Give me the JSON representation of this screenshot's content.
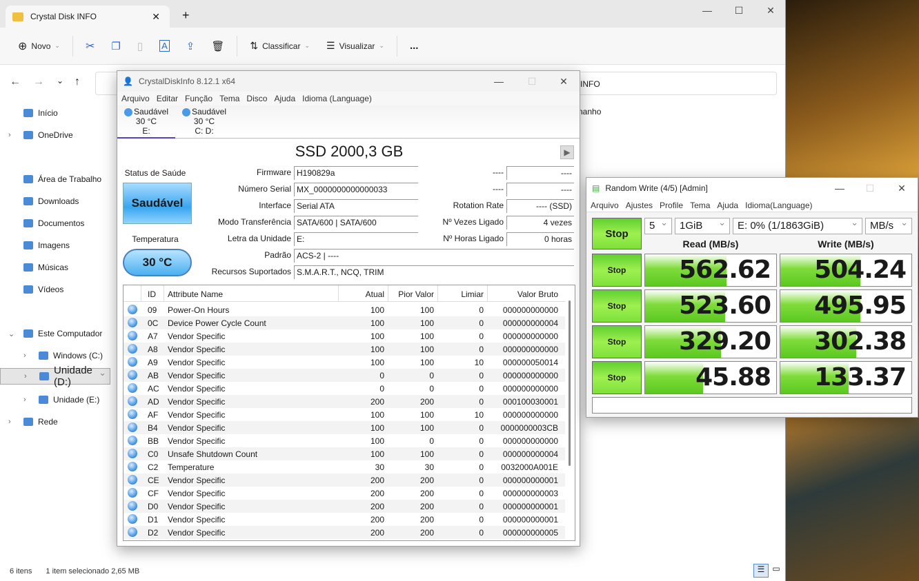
{
  "explorer": {
    "tab_title": "Crystal Disk INFO",
    "new_tab": "+",
    "toolbar": {
      "new": "Novo",
      "sort": "Classificar",
      "view": "Visualizar",
      "more": "..."
    },
    "address_tail": "INFO",
    "column_tail": "nanho",
    "sidebar": [
      {
        "label": "Início",
        "icon": "home-icon"
      },
      {
        "label": "OneDrive",
        "icon": "cloud-icon",
        "expand": true
      },
      {
        "label": "Área de Trabalho",
        "icon": "desktop-icon"
      },
      {
        "label": "Downloads",
        "icon": "download-icon"
      },
      {
        "label": "Documentos",
        "icon": "document-icon"
      },
      {
        "label": "Imagens",
        "icon": "image-icon"
      },
      {
        "label": "Músicas",
        "icon": "music-icon"
      },
      {
        "label": "Vídeos",
        "icon": "video-icon"
      },
      {
        "label": "Este Computador",
        "icon": "computer-icon",
        "expand": true
      },
      {
        "label": "Windows (C:)",
        "icon": "drive-icon",
        "expand": true
      },
      {
        "label": "Unidade (D:)",
        "icon": "drive-icon",
        "expand": true,
        "selected": true
      },
      {
        "label": "Unidade (E:)",
        "icon": "drive-icon",
        "expand": true
      },
      {
        "label": "Rede",
        "icon": "network-icon",
        "expand": true
      }
    ],
    "status": {
      "items": "6 itens",
      "selection": "1 item selecionado  2,65 MB"
    }
  },
  "cdi": {
    "title": "CrystalDiskInfo 8.12.1 x64",
    "menu": [
      "Arquivo",
      "Editar",
      "Função",
      "Tema",
      "Disco",
      "Ajuda",
      "Idioma (Language)"
    ],
    "disks": [
      {
        "status": "Saudável",
        "temp": "30 °C",
        "letter": "E:"
      },
      {
        "status": "Saudável",
        "temp": "30 °C",
        "letter": "C: D:"
      }
    ],
    "model": "SSD 2000,3 GB",
    "health_label": "Status de Saúde",
    "health": "Saudável",
    "temp_label": "Temperatura",
    "temp": "30 °C",
    "fields": [
      [
        "Firmware",
        "H190829a"
      ],
      [
        "Número Serial",
        "MX_0000000000000033"
      ],
      [
        "Interface",
        "Serial ATA"
      ],
      [
        "Modo Transferência",
        "SATA/600 | SATA/600"
      ],
      [
        "Letra da Unidade",
        "E:"
      ],
      [
        "Padrão",
        "ACS-2 | ----"
      ],
      [
        "Recursos Suportados",
        "S.M.A.R.T., NCQ, TRIM"
      ]
    ],
    "right_fields": [
      [
        "----",
        "----"
      ],
      [
        "----",
        "----"
      ],
      [
        "Rotation Rate",
        "---- (SSD)"
      ],
      [
        "Nº Vezes Ligado",
        "4 vezes"
      ],
      [
        "Nº Horas Ligado",
        "0 horas"
      ]
    ],
    "columns": [
      "ID",
      "Attribute Name",
      "Atual",
      "Pior Valor",
      "Limiar",
      "Valor Bruto"
    ],
    "rows": [
      [
        "09",
        "Power-On Hours",
        "100",
        "100",
        "0",
        "000000000000"
      ],
      [
        "0C",
        "Device Power Cycle Count",
        "100",
        "100",
        "0",
        "000000000004"
      ],
      [
        "A7",
        "Vendor Specific",
        "100",
        "100",
        "0",
        "000000000000"
      ],
      [
        "A8",
        "Vendor Specific",
        "100",
        "100",
        "0",
        "000000000000"
      ],
      [
        "A9",
        "Vendor Specific",
        "100",
        "100",
        "10",
        "000000050014"
      ],
      [
        "AB",
        "Vendor Specific",
        "0",
        "0",
        "0",
        "000000000000"
      ],
      [
        "AC",
        "Vendor Specific",
        "0",
        "0",
        "0",
        "000000000000"
      ],
      [
        "AD",
        "Vendor Specific",
        "200",
        "200",
        "0",
        "000100030001"
      ],
      [
        "AF",
        "Vendor Specific",
        "100",
        "100",
        "10",
        "000000000000"
      ],
      [
        "B4",
        "Vendor Specific",
        "100",
        "100",
        "0",
        "0000000003CB"
      ],
      [
        "BB",
        "Vendor Specific",
        "100",
        "0",
        "0",
        "000000000000"
      ],
      [
        "C0",
        "Unsafe Shutdown Count",
        "100",
        "100",
        "0",
        "000000000004"
      ],
      [
        "C2",
        "Temperature",
        "30",
        "30",
        "0",
        "0032000A001E"
      ],
      [
        "CE",
        "Vendor Specific",
        "200",
        "200",
        "0",
        "000000000001"
      ],
      [
        "CF",
        "Vendor Specific",
        "200",
        "200",
        "0",
        "000000000003"
      ],
      [
        "D0",
        "Vendor Specific",
        "200",
        "200",
        "0",
        "000000000001"
      ],
      [
        "D1",
        "Vendor Specific",
        "200",
        "200",
        "0",
        "000000000001"
      ],
      [
        "D2",
        "Vendor Specific",
        "200",
        "200",
        "0",
        "000000000005"
      ]
    ]
  },
  "cdm": {
    "title": "Random Write (4/5) [Admin]",
    "menu": [
      "Arquivo",
      "Ajustes",
      "Profile",
      "Tema",
      "Ajuda",
      "Idioma(Language)"
    ],
    "main_button": "Stop",
    "count": "5",
    "size": "1GiB",
    "drive": "E: 0% (1/1863GiB)",
    "unit": "MB/s",
    "read_header": "Read (MB/s)",
    "write_header": "Write (MB/s)",
    "results": [
      {
        "button": "Stop",
        "read": "562.62",
        "read_fill": 62,
        "write": "504.24",
        "write_fill": 61
      },
      {
        "button": "Stop",
        "read": "523.60",
        "read_fill": 61,
        "write": "495.95",
        "write_fill": 61
      },
      {
        "button": "Stop",
        "read": "329.20",
        "read_fill": 58,
        "write": "302.38",
        "write_fill": 58
      },
      {
        "button": "Stop",
        "read": "45.88",
        "read_fill": 44,
        "write": "133.37",
        "write_fill": 52
      }
    ],
    "bar_color": "#6fd82c"
  }
}
